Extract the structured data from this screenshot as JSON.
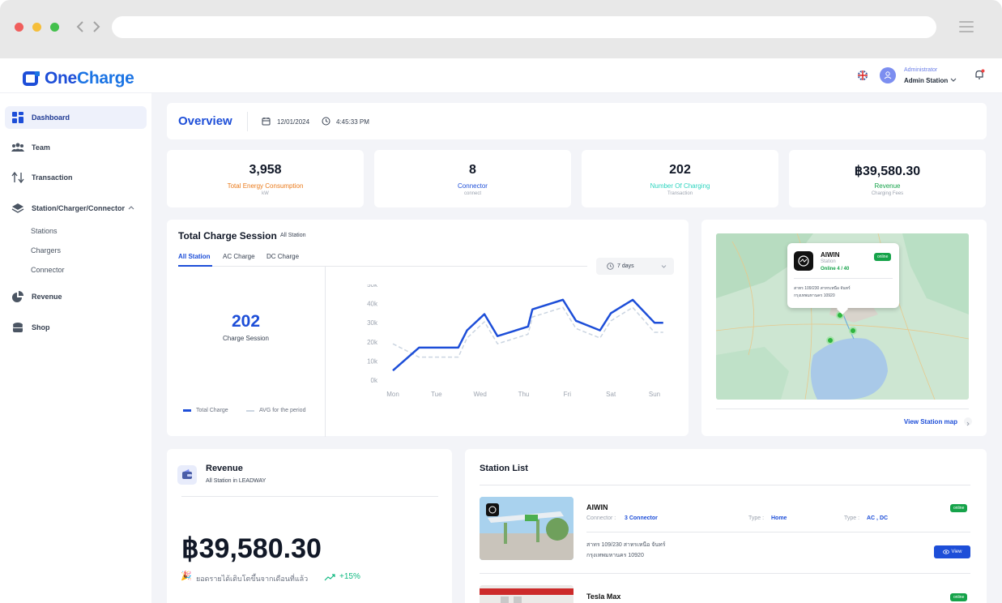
{
  "app": {
    "logo_text_1": "One",
    "logo_text_2": "Charge"
  },
  "user": {
    "role": "Administrator",
    "name": "Admin Station"
  },
  "sidebar": {
    "items": [
      {
        "label": "Dashboard"
      },
      {
        "label": "Team"
      },
      {
        "label": "Transaction"
      },
      {
        "label": "Station/Charger/Connector"
      },
      {
        "label": "Revenue"
      },
      {
        "label": "Shop"
      }
    ],
    "subitems": [
      {
        "label": "Stations"
      },
      {
        "label": "Chargers"
      },
      {
        "label": "Connector"
      }
    ]
  },
  "overview": {
    "title": "Overview",
    "date": "12/01/2024",
    "time": "4:45:33 PM"
  },
  "stats": [
    {
      "value": "3,958",
      "label": "Total Energy Consumption",
      "sub": "kW",
      "color": "#ea7a1a"
    },
    {
      "value": "8",
      "label": "Connector",
      "sub": "connect",
      "color": "#1d4ed8"
    },
    {
      "value": "202",
      "label": "Number Of Charging",
      "sub": "Transaction",
      "color": "#2dd4bf"
    },
    {
      "value": "฿39,580.30",
      "label": "Revenue",
      "sub": "Charging Fees",
      "color": "#16a34a"
    }
  ],
  "session": {
    "title": "Total Charge Session",
    "subtitle": "All Station",
    "tabs": [
      "All Station",
      "AC Charge",
      "DC Charge"
    ],
    "dropdown": "7 days",
    "total": "202",
    "total_label": "Charge Session",
    "legend_total": "Total Charge",
    "legend_avg": "AVG for the period"
  },
  "chart_data": {
    "type": "line",
    "x": [
      "Mon",
      "Tue",
      "Wed",
      "Thu",
      "Fri",
      "Sat",
      "Sun"
    ],
    "yticks": [
      "50k",
      "40k",
      "30k",
      "20k",
      "10k",
      "0k"
    ],
    "ylim": [
      0,
      50000
    ],
    "series": [
      {
        "name": "Total Charge",
        "color": "#1d4ed8",
        "points": [
          [
            0,
            5000
          ],
          [
            0.6,
            17000
          ],
          [
            1.5,
            17000
          ],
          [
            1.7,
            26000
          ],
          [
            2.1,
            34500
          ],
          [
            2.4,
            23000
          ],
          [
            3.1,
            28000
          ],
          [
            3.2,
            37000
          ],
          [
            3.9,
            42000
          ],
          [
            4.2,
            31000
          ],
          [
            4.75,
            26000
          ],
          [
            5,
            35000
          ],
          [
            5.5,
            42000
          ],
          [
            6,
            30000
          ],
          [
            6.2,
            30000
          ]
        ]
      },
      {
        "name": "AVG for the period",
        "color": "#cbd5e1",
        "dashed": true,
        "points": [
          [
            0,
            19000
          ],
          [
            0.6,
            12000
          ],
          [
            1.5,
            12000
          ],
          [
            1.7,
            22000
          ],
          [
            2.1,
            30500
          ],
          [
            2.4,
            19000
          ],
          [
            3.1,
            24000
          ],
          [
            3.2,
            33000
          ],
          [
            3.9,
            38000
          ],
          [
            4.2,
            27000
          ],
          [
            4.75,
            22000
          ],
          [
            5,
            31000
          ],
          [
            5.5,
            38000
          ],
          [
            6,
            25000
          ],
          [
            6.2,
            25000
          ]
        ]
      }
    ]
  },
  "map": {
    "popup_name": "AIWIN",
    "popup_type": "Station",
    "popup_status": "online",
    "popup_online": "Online 4 / 40",
    "popup_addr1": "สาทร 109/230 สาทรเหนือ จันทร์",
    "popup_addr2": "กรุงเทพมหานคร 10920",
    "link": "View Station map"
  },
  "revenue": {
    "title": "Revenue",
    "subtitle": "All Station in LEADWAY",
    "amount": "฿39,580.30",
    "note": "ยอดรายได้เติบโตขึ้นจากเดือนที่แล้ว",
    "pct": "+15%"
  },
  "station_list": {
    "title": "Station List",
    "items": [
      {
        "name": "AIWIN",
        "connector_label": "Connector :",
        "connector": "3 Connector",
        "type1_label": "Type :",
        "type1": "Home",
        "type2_label": "Type :",
        "type2": "AC , DC",
        "status": "online",
        "addr1": "สาทร 109/230 สาทรเหนือ จันทร์",
        "addr2": "กรุงเทพมหานคร 10920",
        "action": "View"
      },
      {
        "name": "Tesla Max",
        "status": "online"
      }
    ]
  }
}
